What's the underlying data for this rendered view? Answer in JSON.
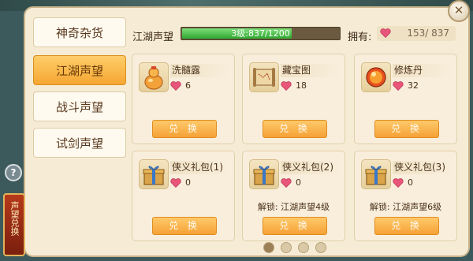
{
  "tabs": [
    {
      "label": "神奇杂货",
      "active": false
    },
    {
      "label": "江湖声望",
      "active": true
    },
    {
      "label": "战斗声望",
      "active": false
    },
    {
      "label": "试剑声望",
      "active": false
    }
  ],
  "header": {
    "reputation_label": "江湖声望",
    "progress_text": "3级:837/1200",
    "progress_fraction": 0.6975,
    "own_label": "拥有:",
    "own_value": "153/ 837"
  },
  "items": [
    {
      "name": "洗髓露",
      "cost": "6",
      "unlock": "",
      "button": "兑 换",
      "icon": "gourd-icon"
    },
    {
      "name": "藏宝图",
      "cost": "18",
      "unlock": "",
      "button": "兑 换",
      "icon": "scroll-map-icon"
    },
    {
      "name": "修炼丹",
      "cost": "32",
      "unlock": "",
      "button": "兑 换",
      "icon": "pill-icon"
    },
    {
      "name": "侠义礼包(1)",
      "cost": "0",
      "unlock": "",
      "button": "兑 换",
      "icon": "gift-box-icon"
    },
    {
      "name": "侠义礼包(2)",
      "cost": "0",
      "unlock": "解锁: 江湖声望4级",
      "button": "兑 换",
      "icon": "gift-box-icon"
    },
    {
      "name": "侠义礼包(3)",
      "cost": "0",
      "unlock": "解锁: 江湖声望6级",
      "button": "兑 换",
      "icon": "gift-box-icon"
    }
  ],
  "side_button": {
    "label": "声望兑换"
  },
  "help": {
    "label": "?"
  },
  "close": {
    "label": "✕"
  },
  "pager": {
    "pages": 4,
    "current": 1
  },
  "colors": {
    "accent": "#f5a236",
    "progress": "#2fa630",
    "heart": "#e8567a"
  }
}
